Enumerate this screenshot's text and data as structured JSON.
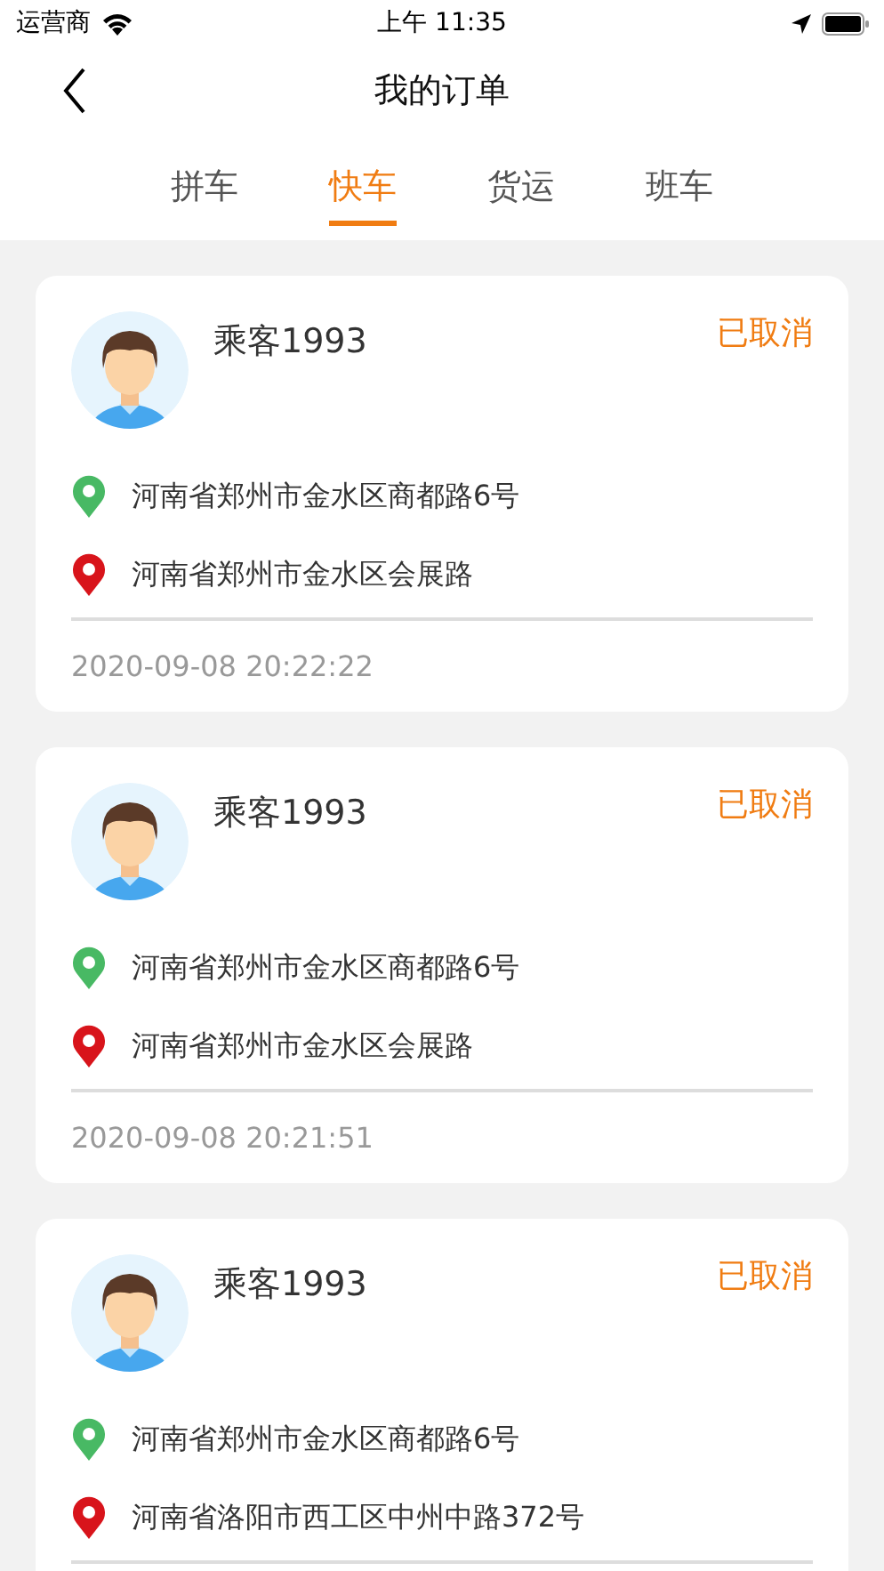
{
  "status_bar": {
    "carrier": "运营商",
    "time": "上午 11:35"
  },
  "nav": {
    "title": "我的订单"
  },
  "tabs": [
    {
      "label": "拼车",
      "selected": false
    },
    {
      "label": "快车",
      "selected": true
    },
    {
      "label": "货运",
      "selected": false
    },
    {
      "label": "班车",
      "selected": false
    }
  ],
  "orders": [
    {
      "passenger": "乘客1993",
      "status": "已取消",
      "from": "河南省郑州市金水区商都路6号",
      "to": "河南省郑州市金水区会展路",
      "time": "2020-09-08 20:22:22"
    },
    {
      "passenger": "乘客1993",
      "status": "已取消",
      "from": "河南省郑州市金水区商都路6号",
      "to": "河南省郑州市金水区会展路",
      "time": "2020-09-08 20:21:51"
    },
    {
      "passenger": "乘客1993",
      "status": "已取消",
      "from": "河南省郑州市金水区商都路6号",
      "to": "河南省洛阳市西工区中州中路372号"
    }
  ]
}
